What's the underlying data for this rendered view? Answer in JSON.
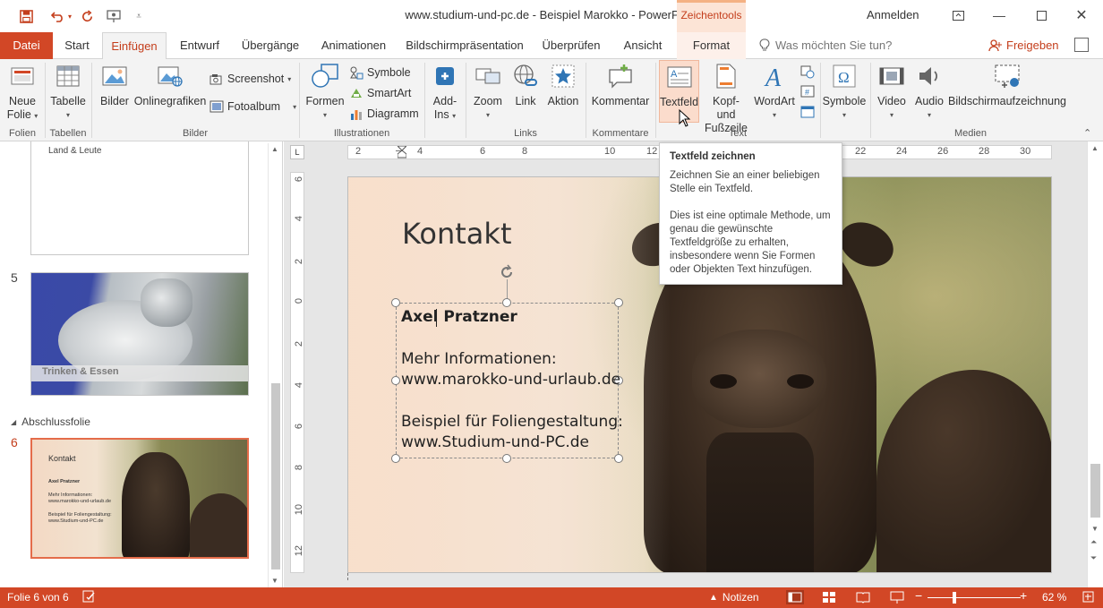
{
  "window": {
    "title": "www.studium-und-pc.de - Beispiel Marokko  -  PowerPoint",
    "context_tab_group": "Zeichentools",
    "sign_in": "Anmelden"
  },
  "tabs": [
    {
      "label": "Datei"
    },
    {
      "label": "Start"
    },
    {
      "label": "Einfügen"
    },
    {
      "label": "Entwurf"
    },
    {
      "label": "Übergänge"
    },
    {
      "label": "Animationen"
    },
    {
      "label": "Bildschirmpräsentation"
    },
    {
      "label": "Überprüfen"
    },
    {
      "label": "Ansicht"
    },
    {
      "label": "Format"
    }
  ],
  "tell_me": {
    "placeholder": "Was möchten Sie tun?"
  },
  "share": {
    "label": "Freigeben"
  },
  "ribbon": {
    "groups": {
      "folien": "Folien",
      "tabellen": "Tabellen",
      "bilder": "Bilder",
      "illustrationen": "Illustrationen",
      "links": "Links",
      "kommentare": "Kommentare",
      "text": "Text",
      "medien": "Medien"
    },
    "buttons": {
      "neue_folie_1": "Neue",
      "neue_folie_2": "Folie",
      "tabelle": "Tabelle",
      "bilder": "Bilder",
      "onlinegrafiken": "Onlinegrafiken",
      "screenshot": "Screenshot",
      "fotoalbum": "Fotoalbum",
      "formen": "Formen",
      "symbole_small": "Symbole",
      "smartart": "SmartArt",
      "diagramm": "Diagramm",
      "addins_1": "Add-",
      "addins_2": "Ins",
      "zoom": "Zoom",
      "link": "Link",
      "aktion": "Aktion",
      "kommentar": "Kommentar",
      "textfeld": "Textfeld",
      "kopf_1": "Kopf- und",
      "kopf_2": "Fußzeile",
      "wordart": "WordArt",
      "symbole_big": "Symbole",
      "video": "Video",
      "audio": "Audio",
      "bildschirmaufzeichnung": "Bildschirmaufzeichnung"
    }
  },
  "thumbnails": {
    "slide4_caption": "Land & Leute",
    "slide5_number": "5",
    "slide5_caption": "Trinken & Essen",
    "section_label": "Abschlussfolie",
    "slide6_number": "6",
    "slide6": {
      "title": "Kontakt",
      "name": "Axel Pratzner",
      "line1": "Mehr Informationen:",
      "line2": "www.marokko-und-urlaub.de",
      "line3": "Beispiel für Foliengestaltung:",
      "line4": "www.Studium-und-PC.de"
    }
  },
  "hruler_ticks": [
    "2",
    "4",
    "6",
    "8",
    "10",
    "12",
    "22",
    "24",
    "26",
    "28",
    "30"
  ],
  "vruler_ticks": [
    "6",
    "4",
    "2",
    "0",
    "2",
    "4",
    "6",
    "8",
    "10",
    "12"
  ],
  "slide": {
    "title": "Kontakt",
    "name": "Axel Pratzner",
    "line1": "Mehr Informationen:",
    "line2": "www.marokko-und-urlaub.de",
    "line3": "Beispiel für Foliengestaltung:",
    "line4": "www.Studium-und-PC.de"
  },
  "tooltip": {
    "title": "Textfeld zeichnen",
    "p1": "Zeichnen Sie an einer beliebigen Stelle ein Textfeld.",
    "p2": "Dies ist eine optimale Methode, um genau die gewünschte Textfeldgröße zu erhalten, insbesondere wenn Sie Formen oder Objekten Text hinzufügen."
  },
  "status": {
    "slide_info": "Folie 6 von 6",
    "notes": "Notizen",
    "zoom": "62 %"
  },
  "colors": {
    "accent": "#d24726",
    "accent_text": "#c43e1c",
    "ribbon_bg": "#f3f3f3"
  }
}
